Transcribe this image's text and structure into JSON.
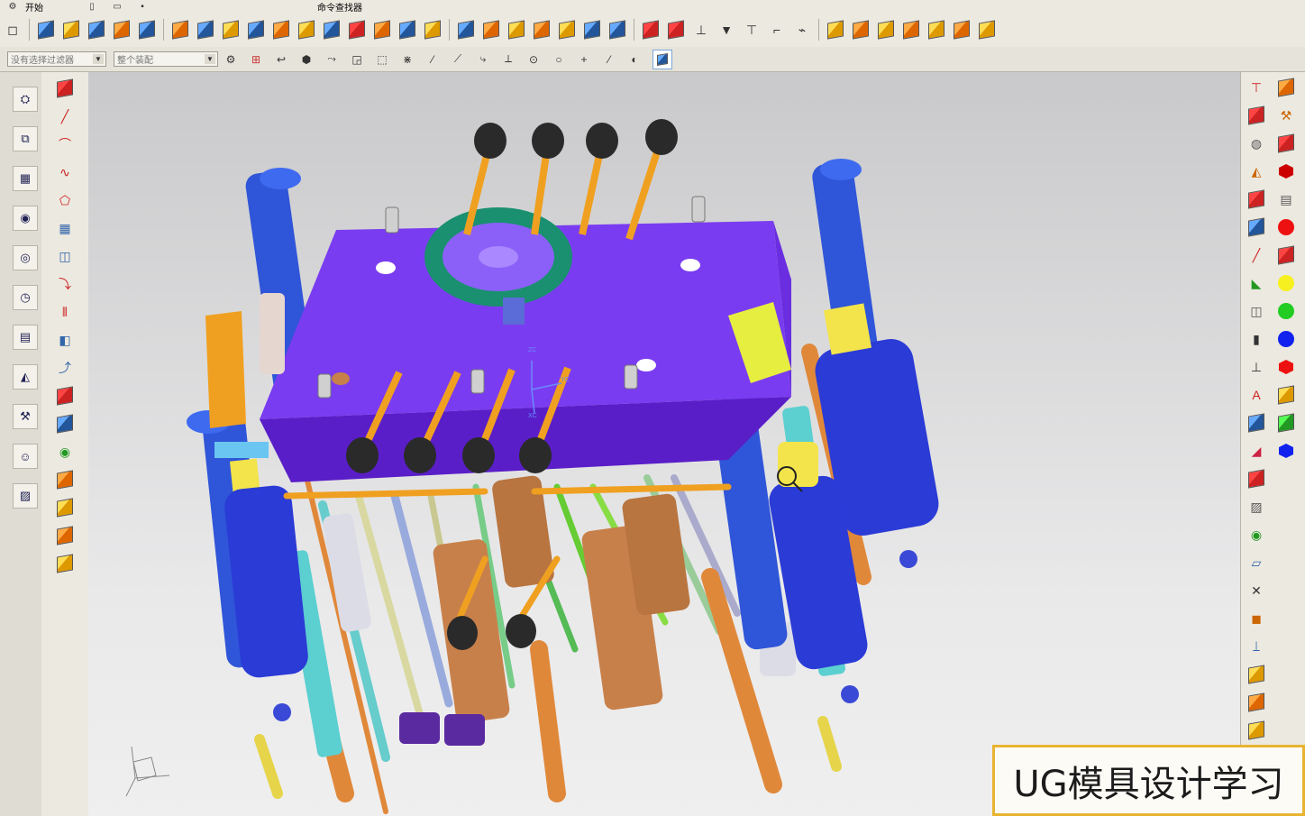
{
  "menu": {
    "start_label": "开始",
    "command_finder": "命令查找器"
  },
  "selection_bar": {
    "filter": "没有选择过滤器",
    "scope": "整个装配"
  },
  "watermark": "UG模具设计学习",
  "triad": {
    "x": "XC",
    "y": "YC",
    "z": "ZC"
  },
  "colors": {
    "plate": "#7a3cf0",
    "plate_side": "#5a1ec8",
    "ring": "#1a9070",
    "spring": "#2b3bd6",
    "pillar": "#2f55d8",
    "pipe": "#f0a020",
    "rod": "#e0883a",
    "cylinder": "#c8804a",
    "accent_yellow": "#f2e44a",
    "accent_cyan": "#5ccfd0"
  }
}
